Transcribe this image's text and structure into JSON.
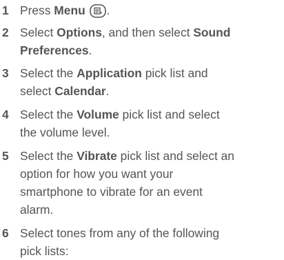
{
  "steps": [
    {
      "number": "1",
      "before": "Press ",
      "bold": "Menu",
      "icon": "menu-key-icon",
      "after": "."
    },
    {
      "number": "2",
      "l1_a": "Select ",
      "l1_b1": "Options",
      "l1_c": ", and then select ",
      "l1_b2": "Sound",
      "l2_b": "Preferences",
      "l2_c": "."
    },
    {
      "number": "3",
      "l1_a": "Select the ",
      "l1_b": "Application",
      "l1_c": " pick list and",
      "l2_a": "select ",
      "l2_b": "Calendar",
      "l2_c": "."
    },
    {
      "number": "4",
      "l1_a": "Select the ",
      "l1_b": "Volume",
      "l1_c": " pick list and select",
      "l2": "the volume level."
    },
    {
      "number": "5",
      "l1_a": "Select the ",
      "l1_b": "Vibrate",
      "l1_c": " pick list and select an",
      "l2": "option for how you want your",
      "l3": "smartphone to vibrate for an event",
      "l4": "alarm."
    },
    {
      "number": "6",
      "l1": "Select tones from any of the following",
      "l2": "pick lists:"
    }
  ]
}
